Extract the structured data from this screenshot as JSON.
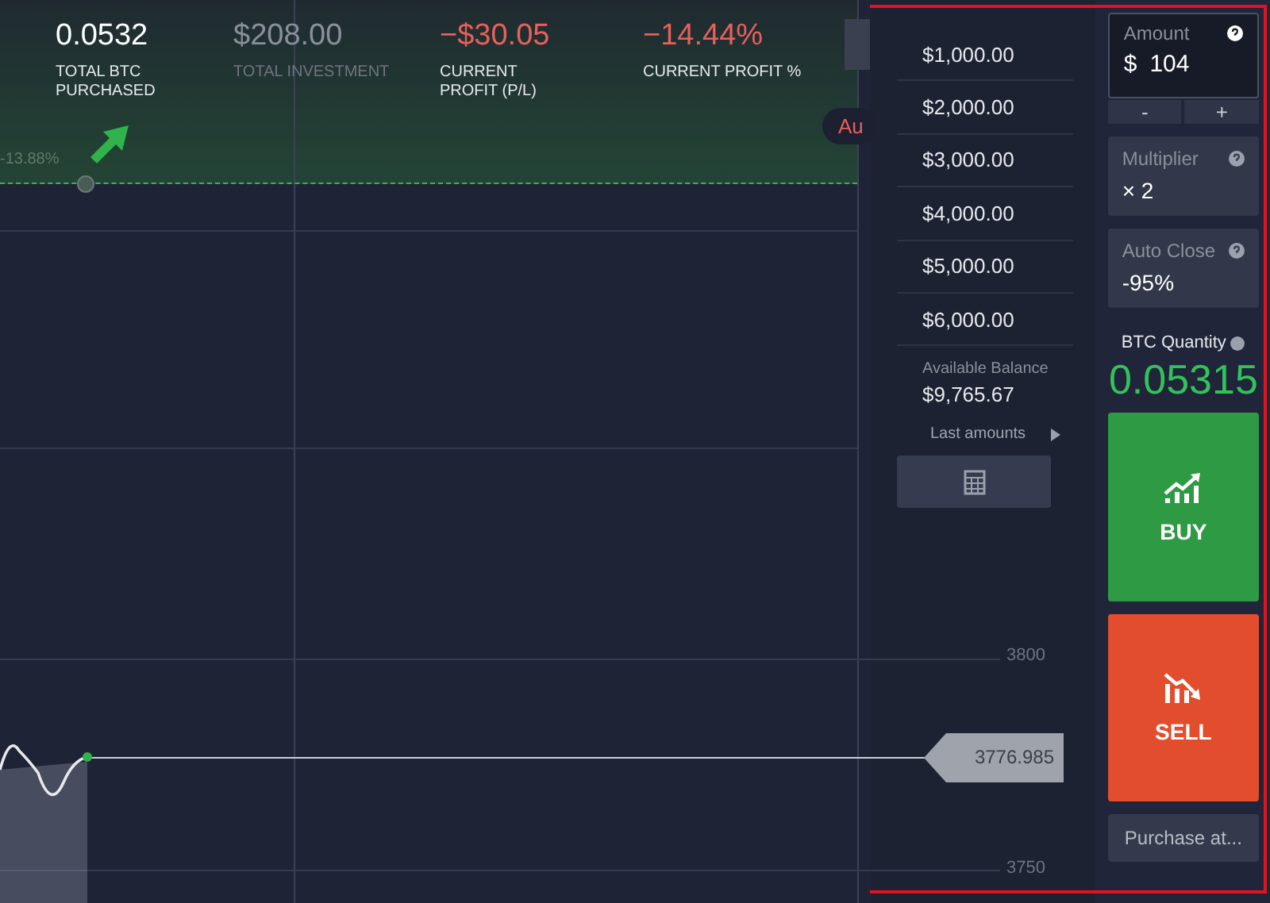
{
  "stats": [
    {
      "value": "0.0532",
      "label": "TOTAL BTC PURCHASED",
      "kind": "neutral"
    },
    {
      "value": "$208.00",
      "label": "TOTAL INVESTMENT",
      "kind": "muted"
    },
    {
      "value": "−$30.05",
      "label": "CURRENT PROFIT (P/L)",
      "kind": "loss"
    },
    {
      "value": "−14.44%",
      "label": "CURRENT PROFIT %",
      "kind": "loss"
    }
  ],
  "chart": {
    "position_label": "-13.88%",
    "auto_pill": "Au",
    "price_levels": [
      "3800",
      "3750"
    ],
    "current_price": "3776.985"
  },
  "amount_presets": [
    "$1,000.00",
    "$2,000.00",
    "$3,000.00",
    "$4,000.00",
    "$5,000.00",
    "$6,000.00"
  ],
  "balance": {
    "label": "Available Balance",
    "value": "$9,765.67"
  },
  "last_amounts": {
    "label": "Last amounts"
  },
  "amount": {
    "label": "Amount",
    "currency": "$",
    "value": "104",
    "decrement": "-",
    "increment": "+"
  },
  "multiplier": {
    "label": "Multiplier",
    "value": "× 2"
  },
  "auto_close": {
    "label": "Auto Close",
    "value": "-95%"
  },
  "btc_quantity": {
    "label": "BTC Quantity",
    "value": "0.05315"
  },
  "buy": {
    "label": "BUY"
  },
  "sell": {
    "label": "SELL"
  },
  "purchase_at": {
    "label": "Purchase at..."
  }
}
